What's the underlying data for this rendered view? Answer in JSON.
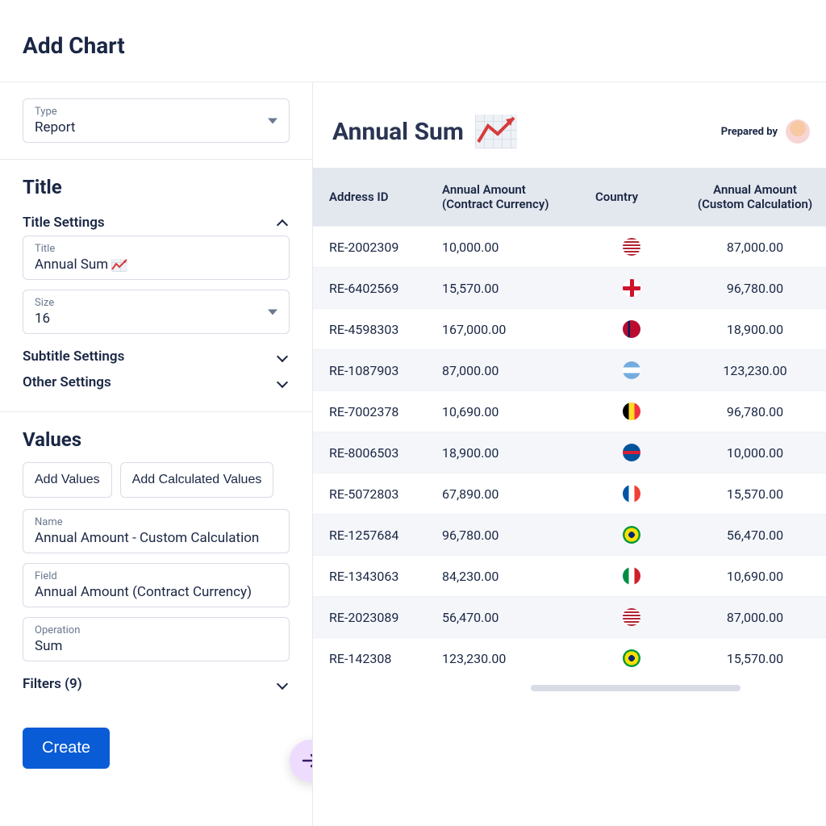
{
  "header": {
    "title": "Add Chart"
  },
  "typeField": {
    "label": "Type",
    "value": "Report"
  },
  "titleSection": {
    "heading": "Title",
    "titleSettings": {
      "label": "Title Settings",
      "expanded": true
    },
    "titleField": {
      "label": "Title",
      "value": "Annual Sum"
    },
    "sizeField": {
      "label": "Size",
      "value": "16"
    },
    "subtitleSettings": {
      "label": "Subtitle Settings"
    },
    "otherSettings": {
      "label": "Other Settings"
    }
  },
  "valuesSection": {
    "heading": "Values",
    "addValues": "Add Values",
    "addCalculated": "Add Calculated  Values",
    "nameField": {
      "label": "Name",
      "value": "Annual Amount - Custom Calculation"
    },
    "fieldField": {
      "label": "Field",
      "value": "Annual Amount (Contract Currency)"
    },
    "operationField": {
      "label": "Operation",
      "value": "Sum"
    }
  },
  "filters": {
    "label": "Filters (9)"
  },
  "createButton": "Create",
  "preview": {
    "title": "Annual Sum",
    "preparedBy": "Prepared by",
    "columns": [
      "Address ID",
      "Annual Amount (Contract Currency)",
      "Country",
      "Annual Amount (Custom Calculation)"
    ],
    "rows": [
      {
        "id": "RE-2002309",
        "amount": "10,000.00",
        "country": "us",
        "custom": "87,000.00"
      },
      {
        "id": "RE-6402569",
        "amount": "15,570.00",
        "country": "en",
        "custom": "96,780.00"
      },
      {
        "id": "RE-4598303",
        "amount": "167,000.00",
        "country": "no",
        "custom": "18,900.00"
      },
      {
        "id": "RE-1087903",
        "amount": "87,000.00",
        "country": "ar",
        "custom": "123,230.00"
      },
      {
        "id": "RE-7002378",
        "amount": "10,690.00",
        "country": "be",
        "custom": "96,780.00"
      },
      {
        "id": "RE-8006503",
        "amount": "18,900.00",
        "country": "is",
        "custom": "10,000.00"
      },
      {
        "id": "RE-5072803",
        "amount": "67,890.00",
        "country": "fr",
        "custom": "15,570.00"
      },
      {
        "id": "RE-1257684",
        "amount": "96,780.00",
        "country": "br",
        "custom": "56,470.00"
      },
      {
        "id": "RE-1343063",
        "amount": "84,230.00",
        "country": "it",
        "custom": "10,690.00"
      },
      {
        "id": "RE-2023089",
        "amount": "56,470.00",
        "country": "us",
        "custom": "87,000.00"
      },
      {
        "id": "RE-142308",
        "amount": "123,230.00",
        "country": "br",
        "custom": "15,570.00"
      }
    ]
  },
  "flagColors": {
    "us": "repeating-linear-gradient(0deg,#b22234 0 2px,#fff 2px 4px), linear-gradient(135deg,#3c3b6e 0 40%, transparent 40%)",
    "en": "linear-gradient(#fff,#fff)",
    "no": "linear-gradient(90deg,#ba0c2f 0 30%,#00205b 30% 40%,#ba0c2f 40% 100%)",
    "ar": "linear-gradient(0deg,#74acdf 0 33%,#fff 33% 66%,#74acdf 66% 100%)",
    "be": "linear-gradient(90deg,#000 0 33%,#fdda24 33% 66%,#ef3340 66% 100%)",
    "is": "linear-gradient(0deg,#02529c 0 40%,#dc1e35 40% 60%,#02529c 60% 100%)",
    "fr": "linear-gradient(90deg,#0055a4 0 33%,#fff 33% 66%,#ef4135 66% 100%)",
    "br": "radial-gradient(circle,#002776 0 25%,#fedf00 25% 55%,#009739 55% 100%)",
    "it": "linear-gradient(90deg,#008c45 0 33%,#fff 33% 66%,#cd212a 66% 100%)"
  }
}
